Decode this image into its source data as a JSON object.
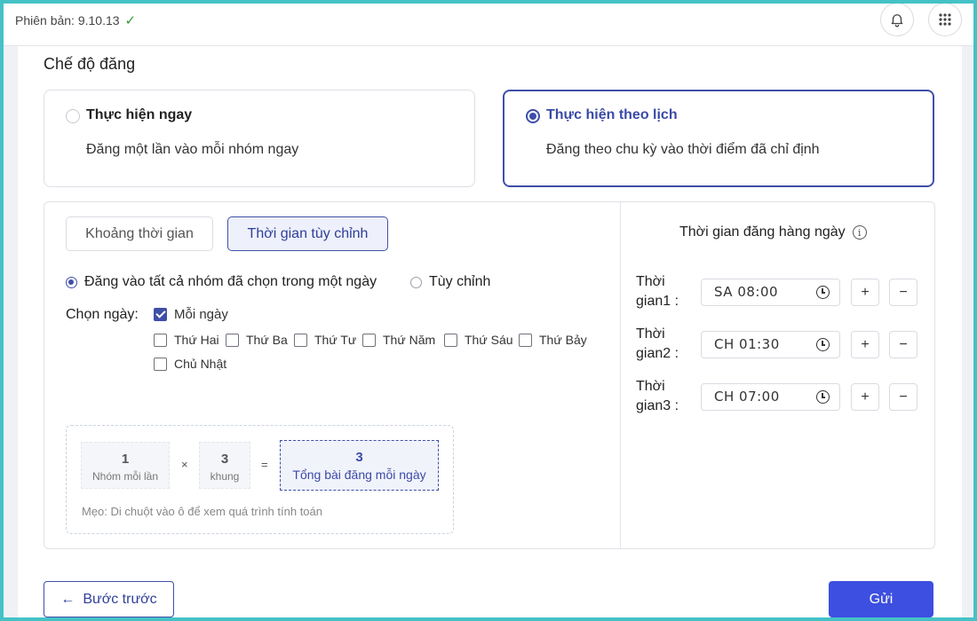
{
  "header": {
    "version_label": "Phiên bản: 9.10.13",
    "check_icon": "check-icon",
    "bell_icon": "bell-icon",
    "apps_icon": "apps-grid-icon"
  },
  "section": {
    "title": "Chế độ đăng"
  },
  "modes": [
    {
      "title": "Thực hiện ngay",
      "desc": "Đăng một lần vào mỗi nhóm ngay",
      "selected": false
    },
    {
      "title": "Thực hiện theo lịch",
      "desc": "Đăng theo chu kỳ vào thời điểm đã chỉ định",
      "selected": true
    }
  ],
  "tabs": [
    {
      "label": "Khoảng thời gian",
      "active": false
    },
    {
      "label": "Thời gian tùy chỉnh",
      "active": true
    }
  ],
  "options": [
    {
      "label": "Đăng vào tất cả nhóm đã chọn trong một ngày",
      "selected": true
    },
    {
      "label": "Tùy chỉnh",
      "selected": false
    }
  ],
  "days": {
    "label": "Chọn ngày:",
    "items": [
      {
        "label": "Mỗi ngày",
        "checked": true
      },
      {
        "label": "Thứ Hai",
        "checked": false
      },
      {
        "label": "Thứ Ba",
        "checked": false
      },
      {
        "label": "Thứ Tư",
        "checked": false
      },
      {
        "label": "Thứ Năm",
        "checked": false
      },
      {
        "label": "Thứ Sáu",
        "checked": false
      },
      {
        "label": "Thứ Bảy",
        "checked": false
      },
      {
        "label": "Chủ Nhật",
        "checked": false
      }
    ]
  },
  "calc": {
    "groups_value": "1",
    "groups_caption": "Nhóm mỗi lần",
    "times_op": "×",
    "slots_value": "3",
    "slots_caption": "khung",
    "equals_op": "=",
    "total_value": "3",
    "total_caption": "Tổng bài đăng mỗi ngày",
    "tip": "Mẹo: Di chuột vào ô để xem quá trình tính toán"
  },
  "schedule": {
    "title": "Thời gian đăng hàng ngày",
    "info_icon_glyph": "i",
    "plus_label": "+",
    "minus_label": "−",
    "times": [
      {
        "label_line1": "Thời",
        "label_line2": "gian1 :",
        "value": "SA 08:00"
      },
      {
        "label_line1": "Thời",
        "label_line2": "gian2 :",
        "value": "CH 01:30"
      },
      {
        "label_line1": "Thời",
        "label_line2": "gian3 :",
        "value": "CH 07:00"
      }
    ]
  },
  "footer": {
    "back_label": "Bước trước",
    "back_arrow": "←",
    "send_label": "Gửi"
  },
  "colors": {
    "accent": "#3f4fa8",
    "primary_button": "#3d4fe0",
    "frame_border": "#45c2c6",
    "check": "#2c9a3a"
  }
}
